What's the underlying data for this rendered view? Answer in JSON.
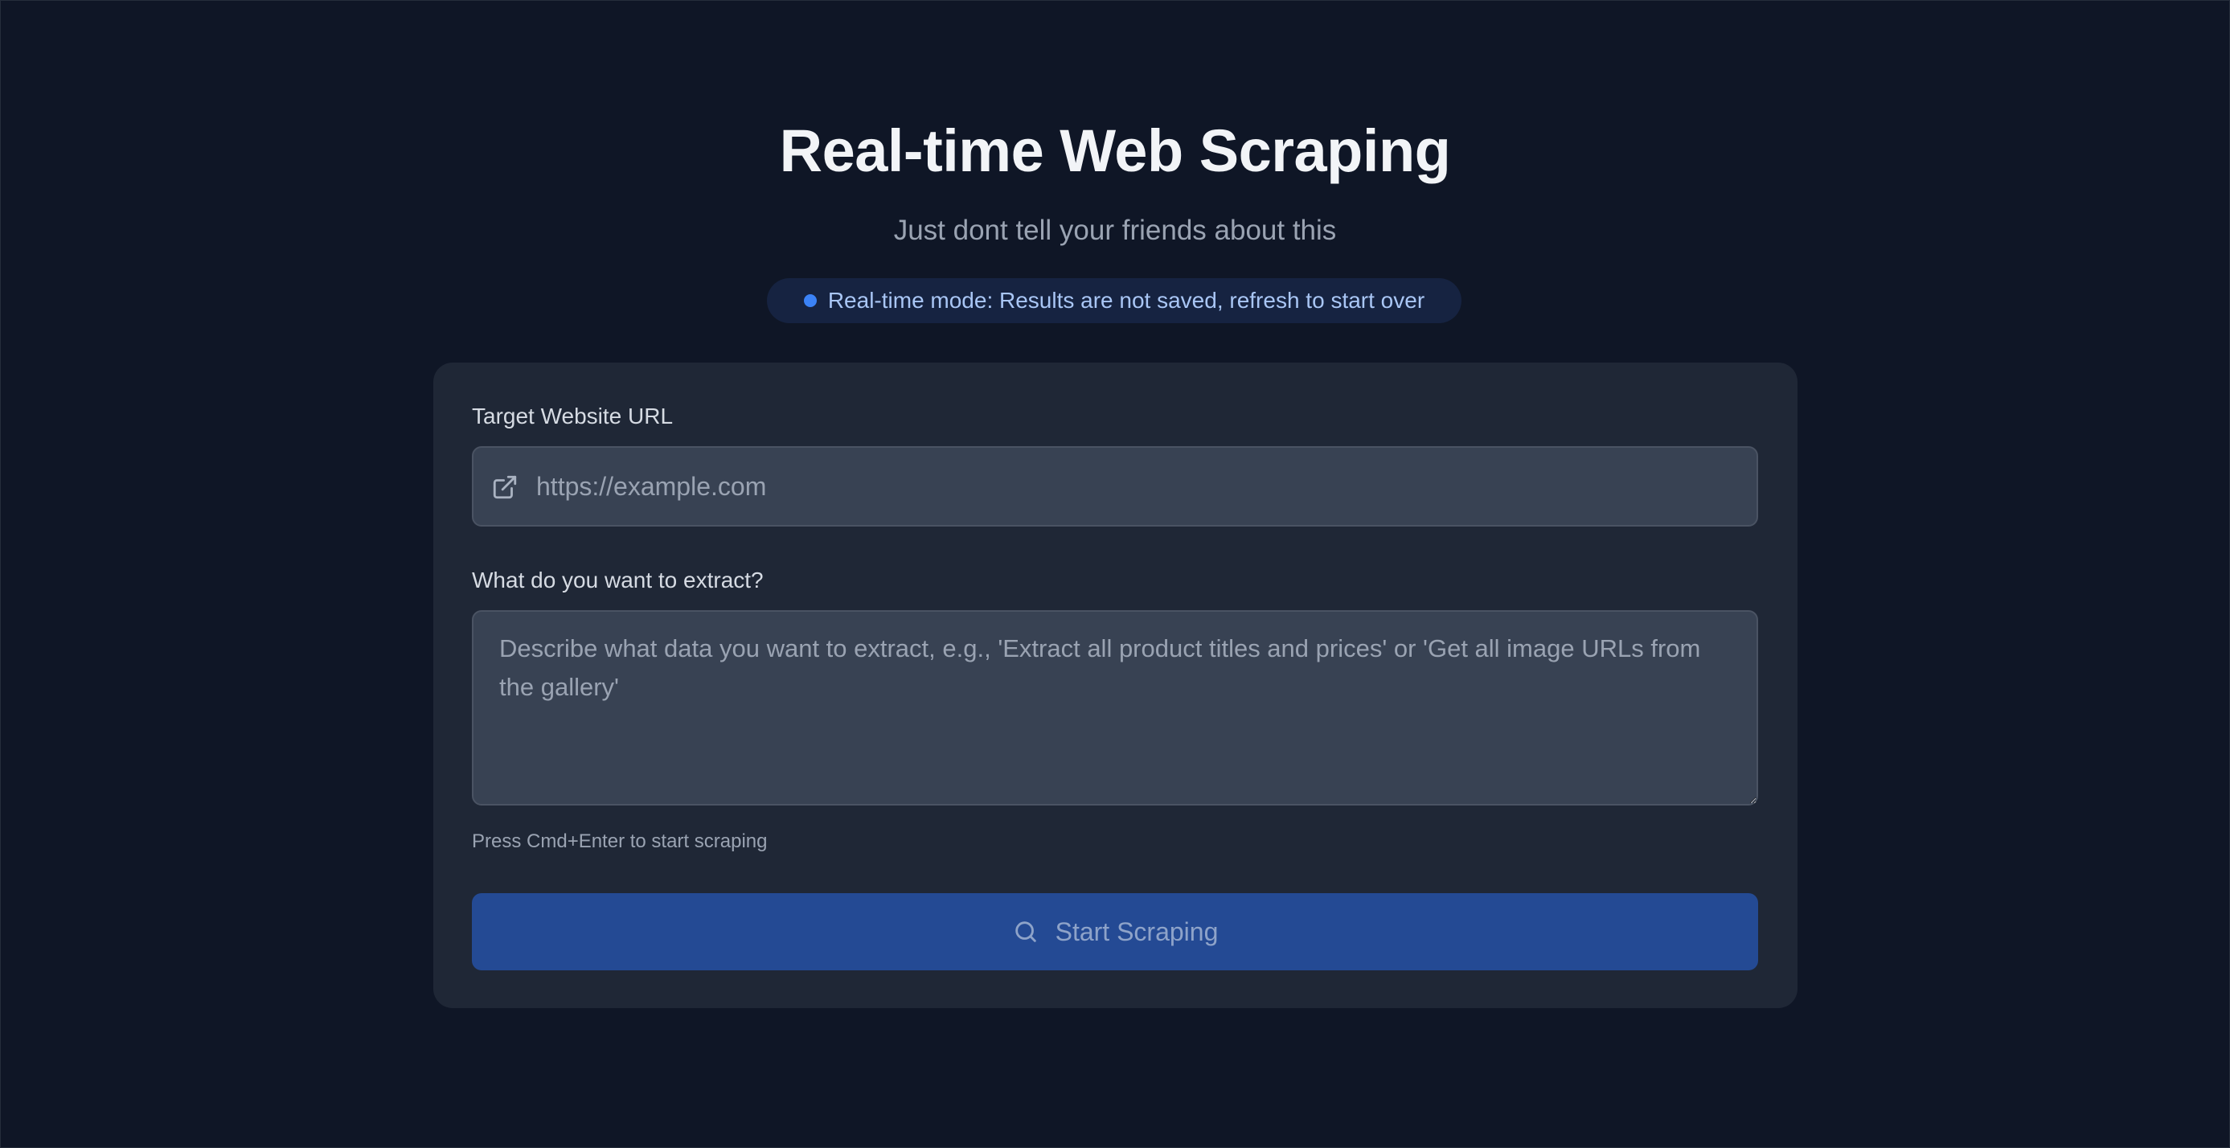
{
  "header": {
    "title": "Real-time Web Scraping",
    "subtitle": "Just dont tell your friends about this",
    "badge": "Real-time mode: Results are not saved, refresh to start over"
  },
  "form": {
    "url_label": "Target Website URL",
    "url_placeholder": "https://example.com",
    "url_value": "",
    "extract_label": "What do you want to extract?",
    "extract_placeholder": "Describe what data you want to extract, e.g., 'Extract all product titles and prices' or 'Get all image URLs from the gallery'",
    "extract_value": "",
    "hint": "Press Cmd+Enter to start scraping",
    "submit_label": "Start Scraping"
  },
  "icons": {
    "url": "external-link-icon",
    "submit": "search-icon"
  },
  "colors": {
    "background": "#0f1626",
    "card": "#1f2736",
    "input": "#384253",
    "accent": "#3b82f6",
    "button": "#244a94",
    "badge": "#162341"
  }
}
